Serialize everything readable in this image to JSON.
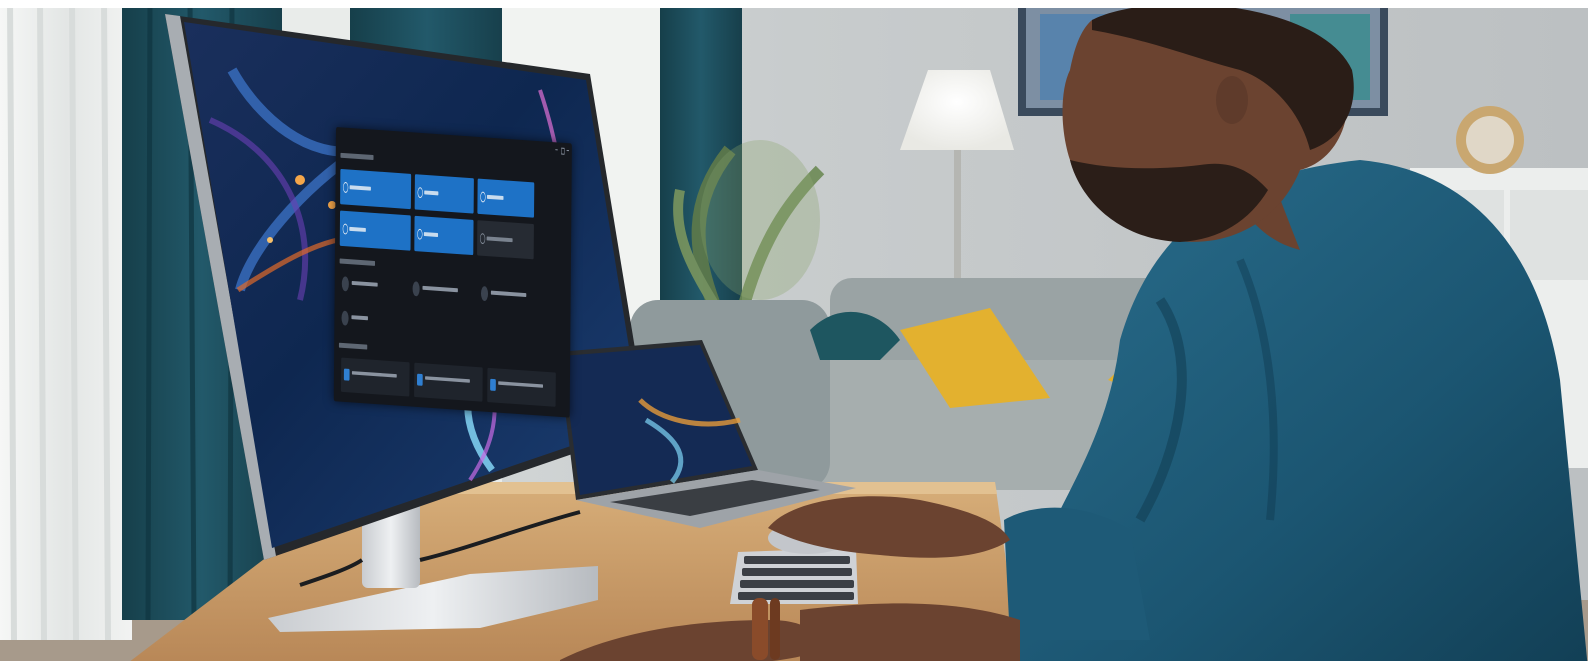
{
  "scene": {
    "description_free": true,
    "colors": {
      "wall": "#c7cacb",
      "curtain": "#1e4f5c",
      "sheer_curtain": "#eef0ef",
      "desk": "#c99d68",
      "shirt": "#1d5b78",
      "skin": "#6b4330",
      "monitor_bezel": "#25282c",
      "screen_bg": "#0f2a55",
      "app_accent": "#1e72c6",
      "pillow": "#e3b12f",
      "sofa": "#9aa3a4"
    },
    "icons": [
      "monitor-icon",
      "laptop-icon",
      "keyboard-icon",
      "mouse-icon",
      "lamp-icon"
    ]
  }
}
